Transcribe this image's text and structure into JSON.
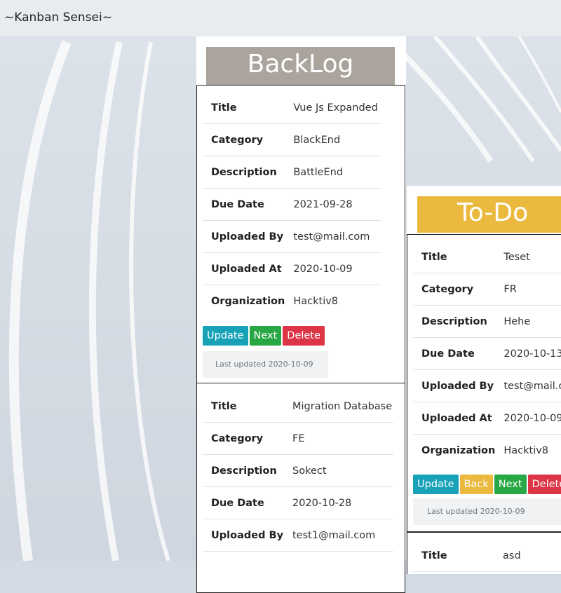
{
  "app": {
    "title": "~Kanban Sensei~"
  },
  "labels": {
    "title": "Title",
    "category": "Category",
    "description": "Description",
    "due_date": "Due Date",
    "uploaded_by": "Uploaded By",
    "uploaded_at": "Uploaded At",
    "organization": "Organization"
  },
  "buttons": {
    "update": "Update",
    "next": "Next",
    "delete": "Delete",
    "back": "Back"
  },
  "backlog": {
    "title": "BackLog",
    "cards": [
      {
        "title": "Vue Js Expanded",
        "category": "BlackEnd",
        "description": "BattleEnd",
        "due_date": "2021-09-28",
        "uploaded_by": "test@mail.com",
        "uploaded_at": "2020-10-09",
        "organization": "Hacktiv8",
        "last_updated": "Last updated 2020-10-09"
      },
      {
        "title": "Migration Database",
        "category": "FE",
        "description": "Sokect",
        "due_date": "2020-10-28",
        "uploaded_by": "test1@mail.com"
      }
    ]
  },
  "todo": {
    "title": "To-Do",
    "cards": [
      {
        "title": "Teset",
        "category": "FR",
        "description": "Hehe",
        "due_date": "2020-10-13",
        "uploaded_by": "test@mail.com",
        "uploaded_at": "2020-10-09",
        "organization": "Hacktiv8",
        "last_updated": "Last updated 2020-10-09"
      },
      {
        "title": "asd"
      }
    ]
  },
  "colors": {
    "backlog_header": "#aba49c",
    "todo_header": "#eab93d"
  }
}
